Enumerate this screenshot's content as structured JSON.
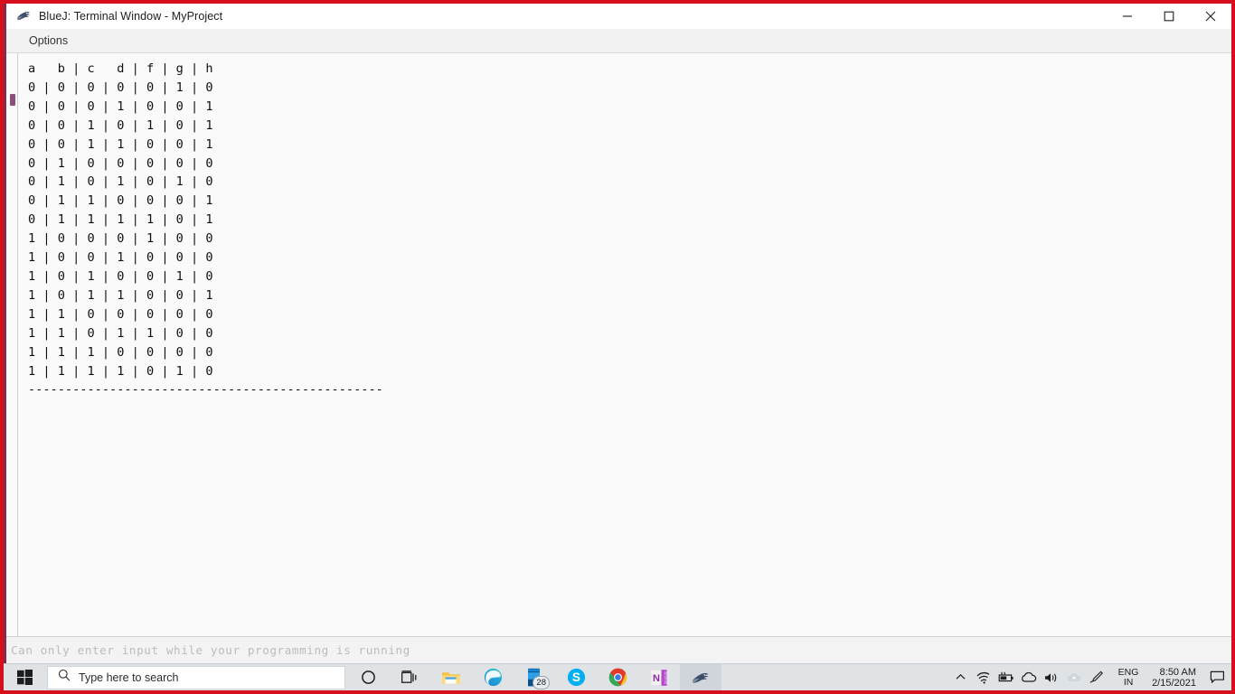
{
  "window": {
    "title": "BlueJ: Terminal Window - MyProject",
    "icon": "bluej-icon",
    "minimize_label": "Minimize",
    "maximize_label": "Maximize",
    "close_label": "Close"
  },
  "menubar": {
    "items": [
      {
        "label": "Options"
      }
    ]
  },
  "terminal": {
    "columns": [
      "a",
      "b",
      "c",
      "d",
      "f",
      "g",
      "h"
    ],
    "header_line": "a   b | c   d | f | g | h",
    "rows": [
      [
        "0",
        "0",
        "0",
        "0",
        "0",
        "1",
        "0"
      ],
      [
        "0",
        "0",
        "0",
        "1",
        "0",
        "0",
        "1"
      ],
      [
        "0",
        "0",
        "1",
        "0",
        "1",
        "0",
        "1"
      ],
      [
        "0",
        "0",
        "1",
        "1",
        "0",
        "0",
        "1"
      ],
      [
        "0",
        "1",
        "0",
        "0",
        "0",
        "0",
        "0"
      ],
      [
        "0",
        "1",
        "0",
        "1",
        "0",
        "1",
        "0"
      ],
      [
        "0",
        "1",
        "1",
        "0",
        "0",
        "0",
        "1"
      ],
      [
        "0",
        "1",
        "1",
        "1",
        "1",
        "0",
        "1"
      ],
      [
        "1",
        "0",
        "0",
        "0",
        "1",
        "0",
        "0"
      ],
      [
        "1",
        "0",
        "0",
        "1",
        "0",
        "0",
        "0"
      ],
      [
        "1",
        "0",
        "1",
        "0",
        "0",
        "1",
        "0"
      ],
      [
        "1",
        "0",
        "1",
        "1",
        "0",
        "0",
        "1"
      ],
      [
        "1",
        "1",
        "0",
        "0",
        "0",
        "0",
        "0"
      ],
      [
        "1",
        "1",
        "0",
        "1",
        "1",
        "0",
        "0"
      ],
      [
        "1",
        "1",
        "1",
        "0",
        "0",
        "0",
        "0"
      ],
      [
        "1",
        "1",
        "1",
        "1",
        "0",
        "1",
        "0"
      ]
    ],
    "separator": "------------------------------------------------",
    "colors": {
      "background": "#fafafa",
      "text": "#101010"
    }
  },
  "statusbar": {
    "message": "Can only enter input while your programming is running"
  },
  "taskbar": {
    "start_label": "Start",
    "search_placeholder": "Type here to search",
    "apps": [
      {
        "name": "cortana-icon",
        "label": "Cortana"
      },
      {
        "name": "task-view-icon",
        "label": "Task View"
      },
      {
        "name": "file-explorer-icon",
        "label": "File Explorer"
      },
      {
        "name": "microsoft-edge-icon",
        "label": "Microsoft Edge"
      },
      {
        "name": "messaging-app-icon",
        "label": "Messaging",
        "badge": "28"
      },
      {
        "name": "skype-icon",
        "label": "Skype"
      },
      {
        "name": "google-chrome-icon",
        "label": "Google Chrome"
      },
      {
        "name": "onenote-icon",
        "label": "OneNote"
      },
      {
        "name": "bluej-icon",
        "label": "BlueJ"
      }
    ],
    "tray": [
      {
        "name": "show-hidden-icons-icon",
        "label": "Show hidden icons"
      },
      {
        "name": "wifi-icon",
        "label": "Network"
      },
      {
        "name": "battery-icon",
        "label": "Battery"
      },
      {
        "name": "onedrive-icon",
        "label": "OneDrive"
      },
      {
        "name": "volume-icon",
        "label": "Volume"
      },
      {
        "name": "cloud-sync-icon",
        "label": "Cloud"
      },
      {
        "name": "pen-workspace-icon",
        "label": "Windows Ink"
      }
    ],
    "language": {
      "line1": "ENG",
      "line2": "IN"
    },
    "clock": {
      "time": "8:50 AM",
      "date": "2/15/2021"
    },
    "notifications_label": "Notifications"
  },
  "accents": {
    "recording_border": "#d5101c",
    "window_accent": "#8a2a4a",
    "scrollbar_thumb": "#8e4e7e"
  }
}
